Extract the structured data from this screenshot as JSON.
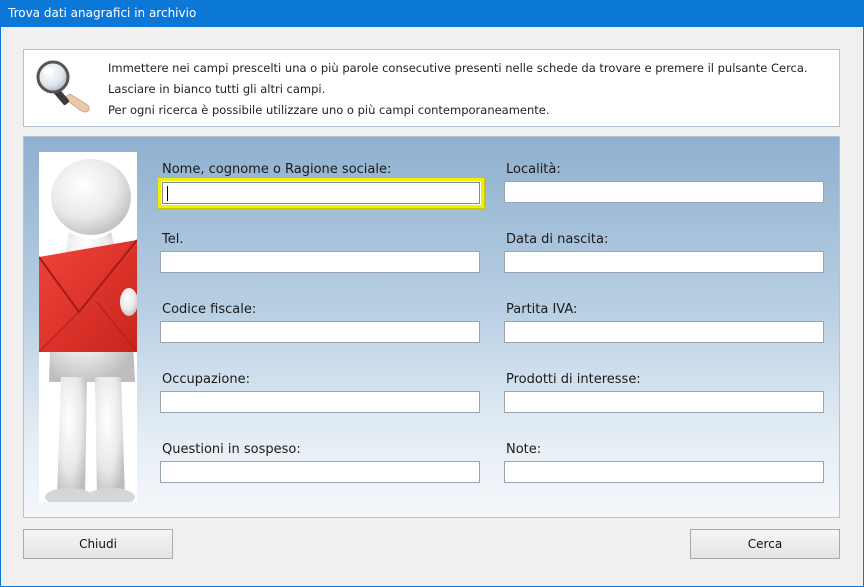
{
  "window": {
    "title": "Trova dati anagrafici in archivio"
  },
  "info": {
    "icon": "magnifier-hand-icon",
    "lines": [
      "Immettere nei campi prescelti una o più parole consecutive presenti nelle schede da trovare e premere il pulsante Cerca.",
      "Lasciare in bianco tutti gli altri campi.",
      "Per ogni ricerca è possibile utilizzare uno o più campi contemporaneamente."
    ]
  },
  "fields": {
    "nome": {
      "label": "Nome, cognome o Ragione sociale:",
      "value": ""
    },
    "localita": {
      "label": "Località:",
      "value": ""
    },
    "tel": {
      "label": "Tel.",
      "value": ""
    },
    "nascita": {
      "label": "Data di nascita:",
      "value": ""
    },
    "cf": {
      "label": "Codice fiscale:",
      "value": ""
    },
    "iva": {
      "label": "Partita IVA:",
      "value": ""
    },
    "occupazione": {
      "label": "Occupazione:",
      "value": ""
    },
    "prodotti": {
      "label": "Prodotti di interesse:",
      "value": ""
    },
    "questioni": {
      "label": "Questioni in sospeso:",
      "value": ""
    },
    "note": {
      "label": "Note:",
      "value": ""
    }
  },
  "buttons": {
    "close": "Chiudi",
    "search": "Cerca"
  },
  "colors": {
    "titlebar": "#0b78d7",
    "focus": "#f0f000",
    "envelope": "#e8352a"
  }
}
